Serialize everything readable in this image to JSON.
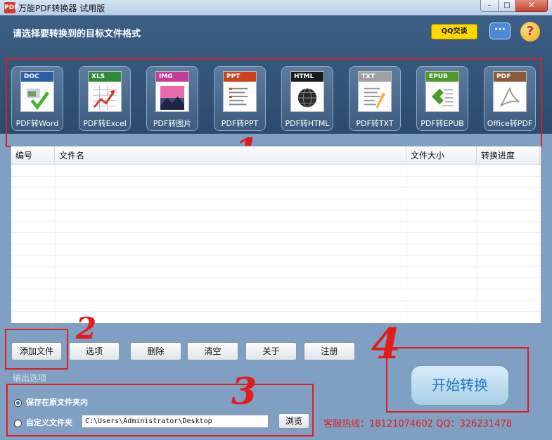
{
  "window": {
    "title": "万能PDF转换器 试用版",
    "app_icon_text": "PDF",
    "close_glyph": "✕",
    "min_glyph": "–",
    "max_glyph": "□"
  },
  "header": {
    "label": "请选择要转换到的目标文件格式",
    "qq_label": "QQ交谈",
    "chat_glyph": "···",
    "help_glyph": "?"
  },
  "formats": [
    {
      "tag": "DOC",
      "label": "PDF转Word",
      "color": "#2b5fa8"
    },
    {
      "tag": "XLS",
      "label": "PDF转Excel",
      "color": "#2f8a3c"
    },
    {
      "tag": "IMG",
      "label": "PDF转图片",
      "color": "#c53c9a"
    },
    {
      "tag": "PPT",
      "label": "PDF转PPT",
      "color": "#c9431f"
    },
    {
      "tag": "HTML",
      "label": "PDF转HTML",
      "color": "#1b1b1b"
    },
    {
      "tag": "TXT",
      "label": "PDF转TXT",
      "color": "#a0a0a0"
    },
    {
      "tag": "EPUB",
      "label": "PDF转EPUB",
      "color": "#4a9a2a"
    },
    {
      "tag": "PDF",
      "label": "Office转PDF",
      "color": "#8a5a3a"
    }
  ],
  "file_list": {
    "columns": [
      "编号",
      "文件名",
      "文件大小",
      "转换进度"
    ]
  },
  "buttons": {
    "add": "添加文件",
    "options": "选项",
    "delete": "删除",
    "clear": "清空",
    "about": "关于",
    "register": "注册"
  },
  "output": {
    "label": "输出选项",
    "save_in_source": "保存在原文件夹内",
    "custom_folder": "自定义文件夹",
    "path": "C:\\Users\\Administrator\\Desktop",
    "browse": "浏览"
  },
  "hotline": "客服热线：18121074602 QQ：326231478",
  "start": "开始转换",
  "annotations": {
    "one": "1",
    "two": "2",
    "three": "3",
    "four": "4"
  }
}
